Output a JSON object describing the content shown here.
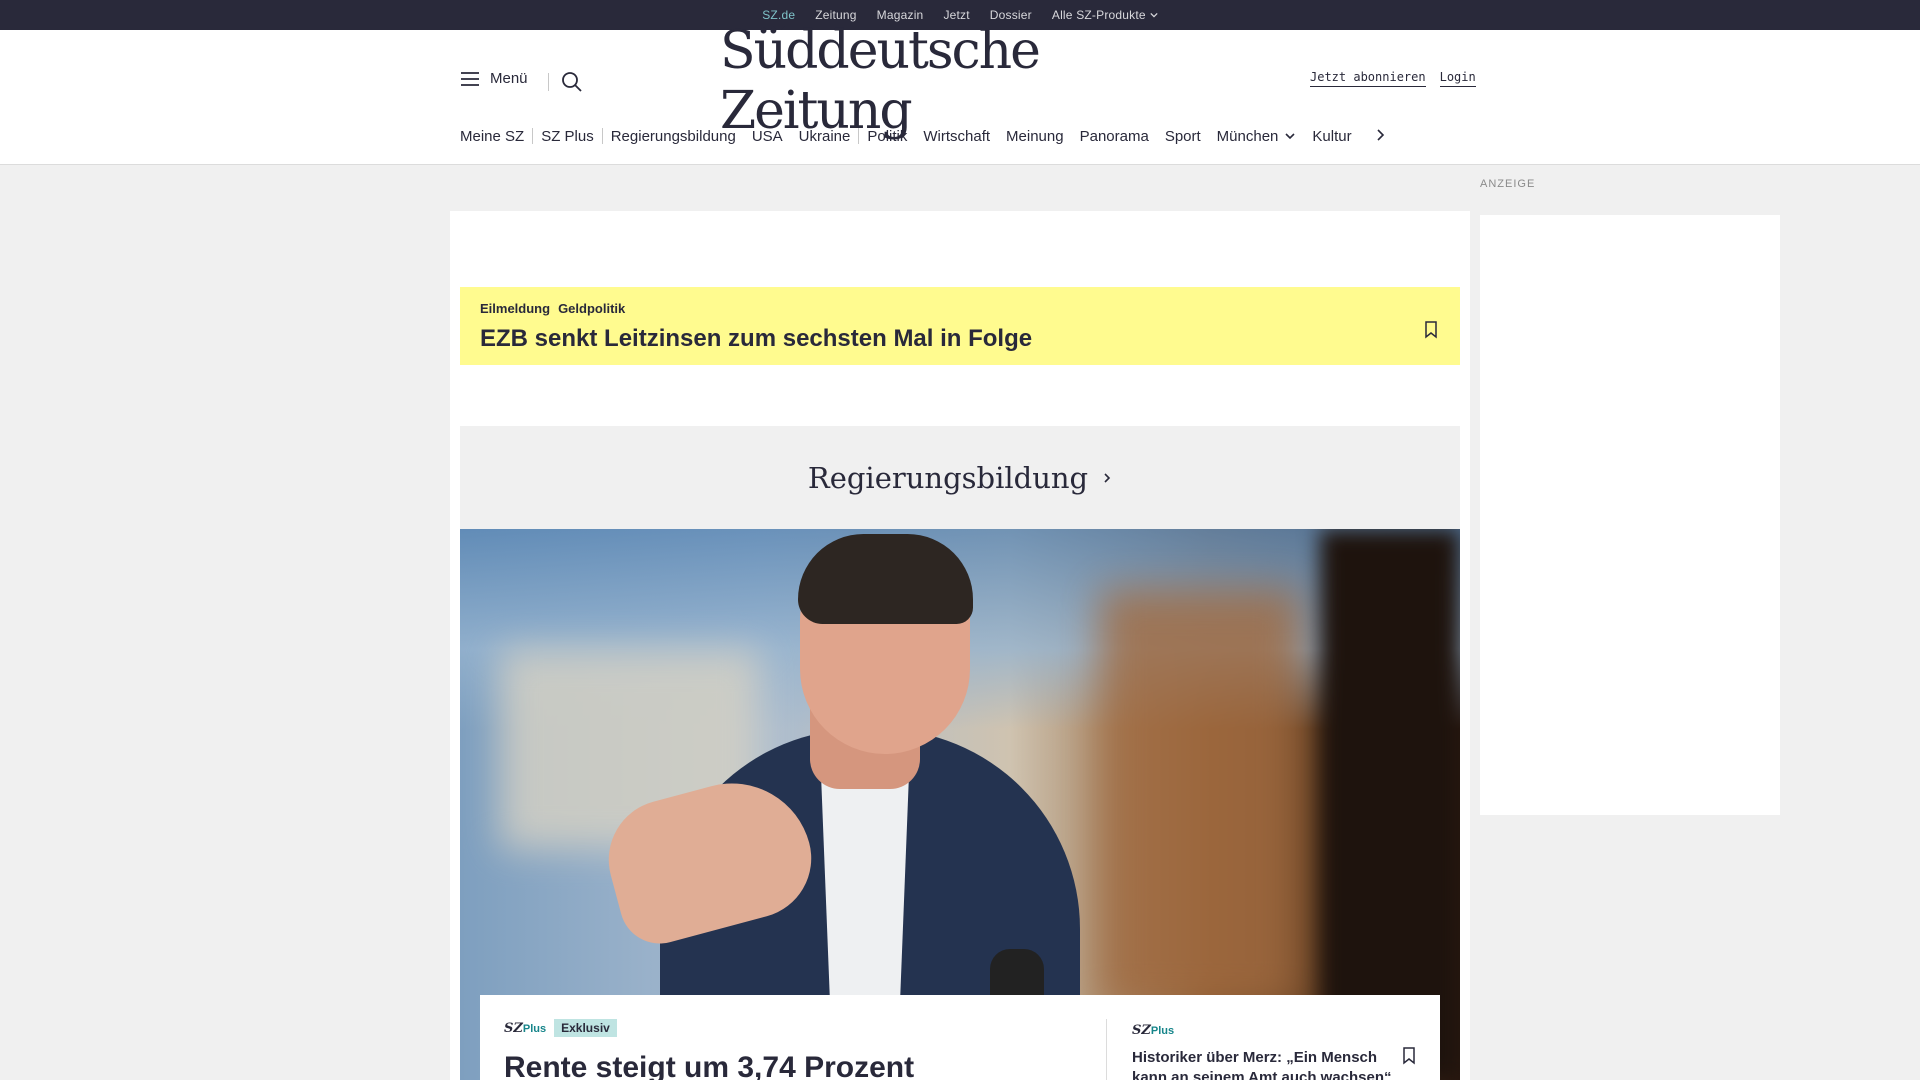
{
  "topbar": {
    "items": [
      {
        "label": "SZ.de",
        "active": true
      },
      {
        "label": "Zeitung"
      },
      {
        "label": "Magazin"
      },
      {
        "label": "Jetzt"
      },
      {
        "label": "Dossier"
      },
      {
        "label": "Alle SZ-Produkte",
        "dropdown": true
      }
    ]
  },
  "header": {
    "menu_label": "Menü",
    "logo_text": "Süddeutsche Zeitung",
    "subscribe_label": "Jetzt abonnieren",
    "login_label": "Login"
  },
  "nav": {
    "items": [
      "Meine SZ",
      "SZ Plus",
      "Regierungsbildung",
      "USA",
      "Ukraine",
      "Politik",
      "Wirtschaft",
      "Meinung",
      "Panorama",
      "Sport",
      "München",
      "Kultur"
    ]
  },
  "ad": {
    "label": "ANZEIGE"
  },
  "breaking": {
    "tag1": "Eilmeldung",
    "tag2": "Geldpolitik",
    "title": "EZB senkt Leitzinsen zum sechsten Mal in Folge"
  },
  "section": {
    "title": "Regierungsbildung"
  },
  "lead": {
    "szplus_sz": "SZ",
    "szplus_plus": "Plus",
    "badge": "Exklusiv",
    "title": "Rente steigt um 3,74 Prozent"
  },
  "side_story": {
    "szplus_sz": "SZ",
    "szplus_plus": "Plus",
    "title": "Historiker über Merz: „Ein Mensch kann an seinem Amt auch wachsen“"
  },
  "colors": {
    "topbar_bg": "#29293a",
    "breaking_bg": "#fffb8f",
    "accent_teal": "#16858a",
    "badge_bg": "#bfe4e2"
  }
}
